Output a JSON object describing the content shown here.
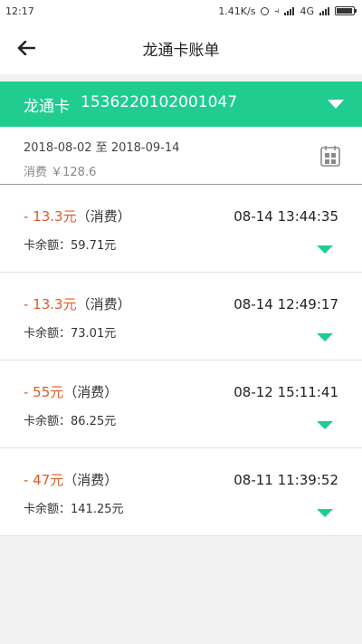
{
  "status_bar": {
    "time": "12:17",
    "network_speed": "1.41K/s",
    "network": "4G",
    "icons": [
      "alarm-icon",
      "vibrate-icon",
      "signal-icon",
      "battery-icon"
    ]
  },
  "nav": {
    "title": "龙通卡账单",
    "back_icon": "arrow-left-icon"
  },
  "card": {
    "label": "龙通卡",
    "number": "1536220102001047",
    "dropdown_icon": "triangle-down-icon",
    "bar_color": "#21cc90"
  },
  "summary": {
    "date_range": "2018-08-02 至 2018-09-14",
    "total": "消费 ￥128.6",
    "calendar_icon": "calendar-icon"
  },
  "transactions": [
    {
      "amount": "- 13.3元",
      "type": "（消费）",
      "time": "08-14 13:44:35",
      "balance": "卡余额：59.71元"
    },
    {
      "amount": "- 13.3元",
      "type": "（消费）",
      "time": "08-14 12:49:17",
      "balance": "卡余额：73.01元"
    },
    {
      "amount": "- 55元",
      "type": "（消费）",
      "time": "08-12 15:11:41",
      "balance": "卡余额：86.25元"
    },
    {
      "amount": "- 47元",
      "type": "（消费）",
      "time": "08-11 11:39:52",
      "balance": "卡余额：141.25元"
    }
  ],
  "colors": {
    "accent": "#21cc90",
    "amount": "#e05a24"
  }
}
